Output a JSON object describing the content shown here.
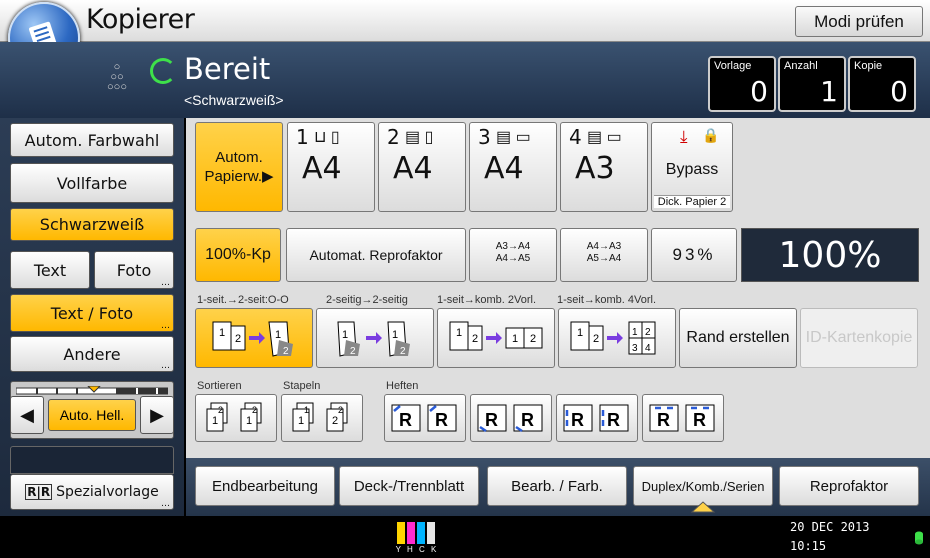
{
  "app": {
    "title": "Kopierer",
    "check_modes_label": "Modi prüfen"
  },
  "status": {
    "state": "Bereit",
    "mode": "<Schwarzweiß>"
  },
  "counters": [
    {
      "label": "Vorlage",
      "value": "0"
    },
    {
      "label": "Anzahl",
      "value": "1"
    },
    {
      "label": "Kopie",
      "value": "0"
    }
  ],
  "color_modes": {
    "auto": "Autom. Farbwahl",
    "full": "Vollfarbe",
    "bw": "Schwarzweiß"
  },
  "original_type": {
    "text": "Text",
    "photo": "Foto",
    "text_photo": "Text / Foto",
    "other": "Andere"
  },
  "density": {
    "label": "Auto. Hell.",
    "left_arrow": "◀",
    "right_arrow": "▶"
  },
  "special": {
    "label": "Spezialvorlage"
  },
  "paper": {
    "auto_label": "Autom.\nPapierw.▶",
    "trays": [
      {
        "num": "1",
        "size": "A4"
      },
      {
        "num": "2",
        "size": "A4"
      },
      {
        "num": "3",
        "size": "A4"
      },
      {
        "num": "4",
        "size": "A3"
      }
    ],
    "bypass": {
      "label": "Bypass",
      "sub": "Dick. Papier 2"
    }
  },
  "reduce": {
    "full": "100%-Kp",
    "auto": "Automat. Reprofaktor",
    "r1_top": "A3→A4",
    "r1_bot": "A4→A5",
    "r2_top": "A4→A3",
    "r2_bot": "A5→A4",
    "percent_btn": "93%",
    "current": "100%"
  },
  "duplex": {
    "labels": [
      "1-seit.→2-seit:O-O",
      "2-seitig→2-seitig",
      "1-seit→komb. 2Vorl.",
      "1-seit→komb. 4Vorl."
    ],
    "margin": "Rand erstellen",
    "id_card": "ID-Kartenkopie"
  },
  "finishing": {
    "sort": "Sortieren",
    "stack": "Stapeln",
    "staple": "Heften"
  },
  "tabs": [
    "Endbearbeitung",
    "Deck-/Trennblatt",
    "Bearb. / Farb.",
    "Duplex/Komb./Serien",
    "Reprofaktor"
  ],
  "clock": {
    "date": "20 DEC  2013",
    "time": "10:15"
  },
  "toner": {
    "letters": "Y H C K"
  }
}
